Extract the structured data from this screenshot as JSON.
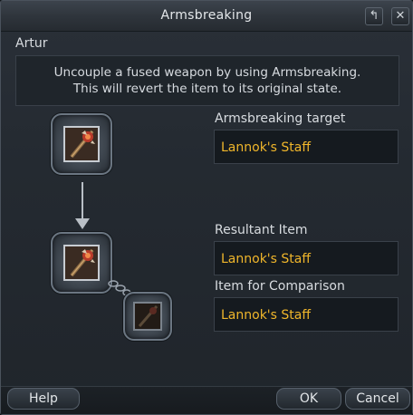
{
  "window": {
    "title": "Armsbreaking",
    "restore_icon": "↰",
    "close_icon": "✕"
  },
  "npc_name": "Artur",
  "description": {
    "line1": "Uncouple a fused weapon by using Armsbreaking.",
    "line2": "This will revert the item to its original state."
  },
  "fields": {
    "target_label": "Armsbreaking target",
    "target_value": "Lannok's Staff",
    "result_label": "Resultant Item",
    "result_value": "Lannok's Staff",
    "comparison_label": "Item for Comparison",
    "comparison_value": "Lannok's Staff"
  },
  "buttons": {
    "help": "Help",
    "ok": "OK",
    "cancel": "Cancel"
  },
  "colors": {
    "item_name": "#f0b62b"
  }
}
